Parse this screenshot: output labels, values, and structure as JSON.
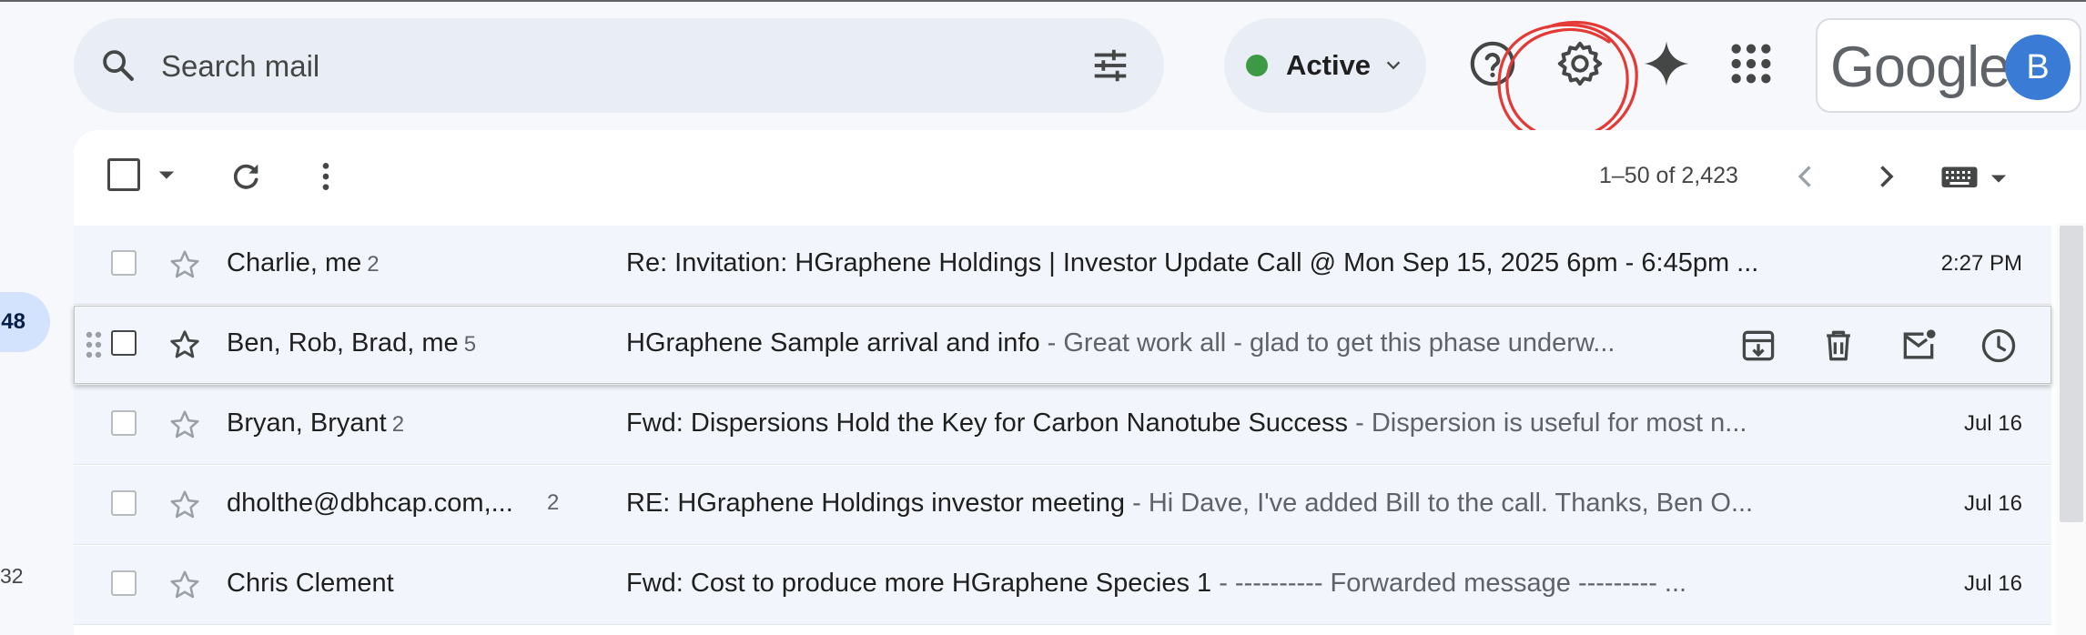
{
  "nav": {
    "badge": "48",
    "count": "32"
  },
  "search": {
    "placeholder": "Search mail"
  },
  "status": {
    "label": "Active",
    "color": "#3c9a45"
  },
  "header_icons": [
    "help-icon",
    "settings-icon",
    "gemini-icon",
    "apps-icon"
  ],
  "account": {
    "logo_text": "Google",
    "initial": "B",
    "avatar_color": "#3a7bd5"
  },
  "annotation": {
    "color": "#e53935",
    "target": "settings-icon"
  },
  "toolbar": {
    "pagination": "1–50 of 2,423"
  },
  "emails": [
    {
      "sender": "Charlie, me",
      "count": "2",
      "subject": "Re: Invitation: HGraphene Holdings | Investor Update Call @ Mon Sep 15, 2025 6pm - 6:45pm ...",
      "snippet": "",
      "date": "2:27 PM"
    },
    {
      "sender": "Ben, Rob, Brad, me",
      "count": "5",
      "subject": "HGraphene Sample arrival and info",
      "snippet": " - Great work all - glad to get this phase underw...",
      "date": ""
    },
    {
      "sender": "Bryan, Bryant",
      "count": "2",
      "subject": "Fwd: Dispersions Hold the Key for Carbon Nanotube Success",
      "snippet": " - Dispersion is useful for most n...",
      "date": "Jul 16"
    },
    {
      "sender": "dholthe@dbhcap.com,...",
      "count": "2",
      "subject": "RE: HGraphene Holdings investor meeting",
      "snippet": " - Hi Dave, I've added Bill to the call. Thanks, Ben O...",
      "date": "Jul 16"
    },
    {
      "sender": "Chris Clement",
      "count": "",
      "subject": "Fwd: Cost to produce more HGraphene Species 1",
      "snippet": " - ---------- Forwarded message --------- ...",
      "date": "Jul 16"
    }
  ],
  "row_actions": [
    "archive-icon",
    "delete-icon",
    "mark-unread-icon",
    "snooze-icon"
  ]
}
